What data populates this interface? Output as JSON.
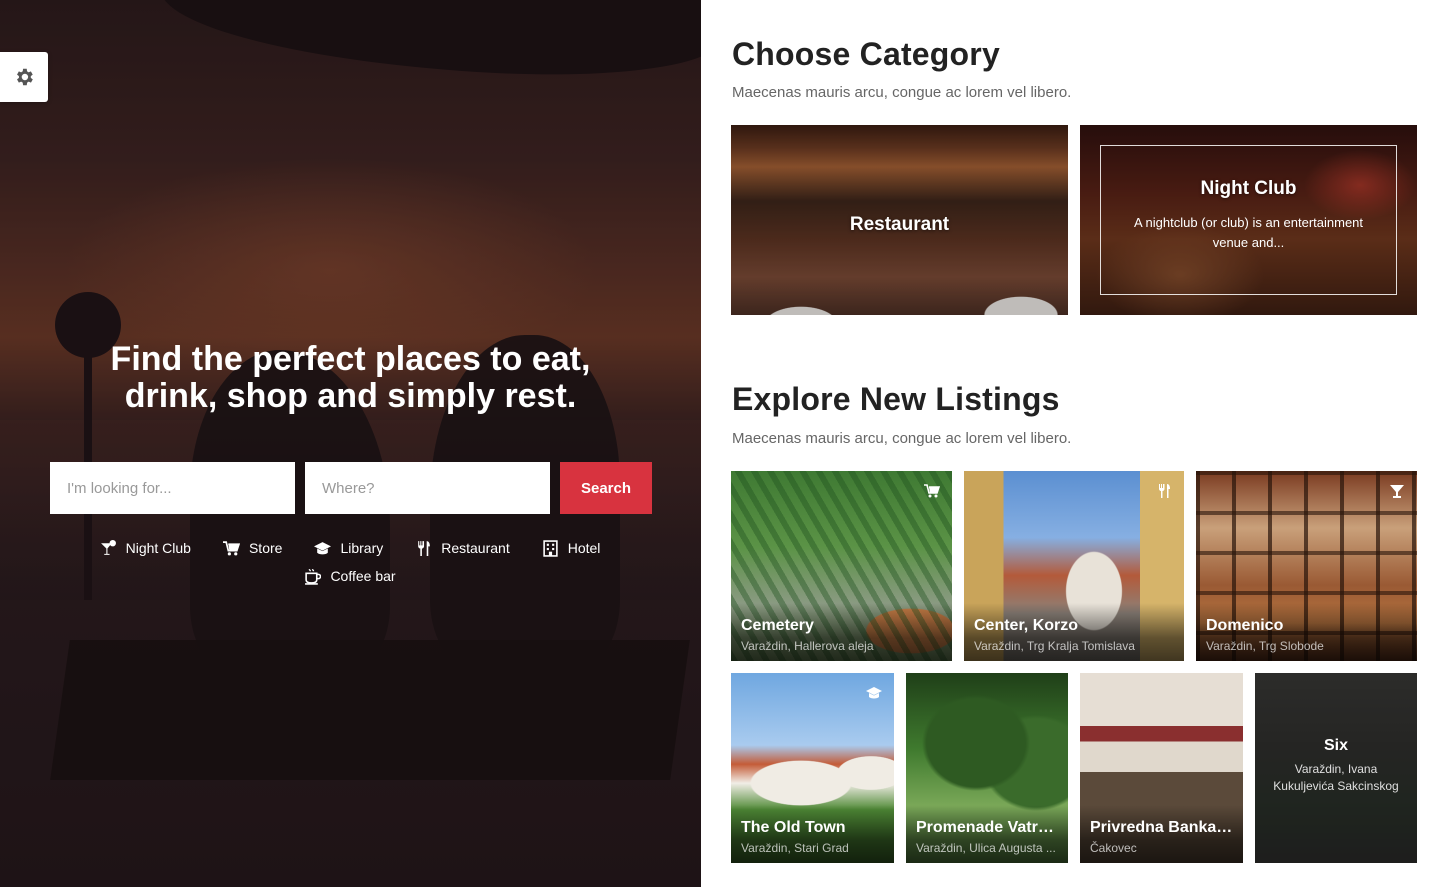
{
  "hero": {
    "title_line1": "Find the perfect places to eat,",
    "title_line2": "drink, shop and simply rest.",
    "search": {
      "what_placeholder": "I'm looking for...",
      "where_placeholder": "Where?",
      "button_label": "Search"
    },
    "categories": [
      {
        "label": "Night Club",
        "icon": "cocktail-icon"
      },
      {
        "label": "Store",
        "icon": "cart-icon"
      },
      {
        "label": "Library",
        "icon": "graduation-cap-icon"
      },
      {
        "label": "Restaurant",
        "icon": "fork-knife-icon"
      },
      {
        "label": "Hotel",
        "icon": "building-icon"
      },
      {
        "label": "Coffee bar",
        "icon": "coffee-cup-icon"
      }
    ]
  },
  "settings": {
    "icon": "gear-icon"
  },
  "choose_category": {
    "title": "Choose Category",
    "subtitle": "Maecenas mauris arcu, congue ac lorem vel libero.",
    "items": [
      {
        "label": "Restaurant"
      },
      {
        "label": "Night Club",
        "description": "A nightclub (or club) is an entertainment venue and..."
      }
    ]
  },
  "explore": {
    "title": "Explore New Listings",
    "subtitle": "Maecenas mauris arcu, congue ac lorem vel libero.",
    "listings": [
      {
        "name": "Cemetery",
        "address": "Varaždin, Hallerova aleja",
        "icon": "cart-icon"
      },
      {
        "name": "Center, Korzo",
        "address": "Varaždin, Trg Kralja Tomislava",
        "icon": "fork-knife-icon"
      },
      {
        "name": "Domenico",
        "address": "Varaždin, Trg Slobode",
        "icon": "cocktail-icon"
      },
      {
        "name": "The Old Town",
        "address": "Varaždin, Stari Grad",
        "icon": "graduation-cap-icon"
      },
      {
        "name": "Promenade Vatro...",
        "address": "Varaždin, Ulica Augusta ..."
      },
      {
        "name": "Privredna Banka Z...",
        "address": "Čakovec"
      },
      {
        "name": "Six",
        "address": "Varaždin, Ivana Kukuljevića Sakcinskog"
      }
    ]
  },
  "colors": {
    "accent": "#d8333f",
    "heading": "#222222",
    "subtext": "#666666"
  }
}
